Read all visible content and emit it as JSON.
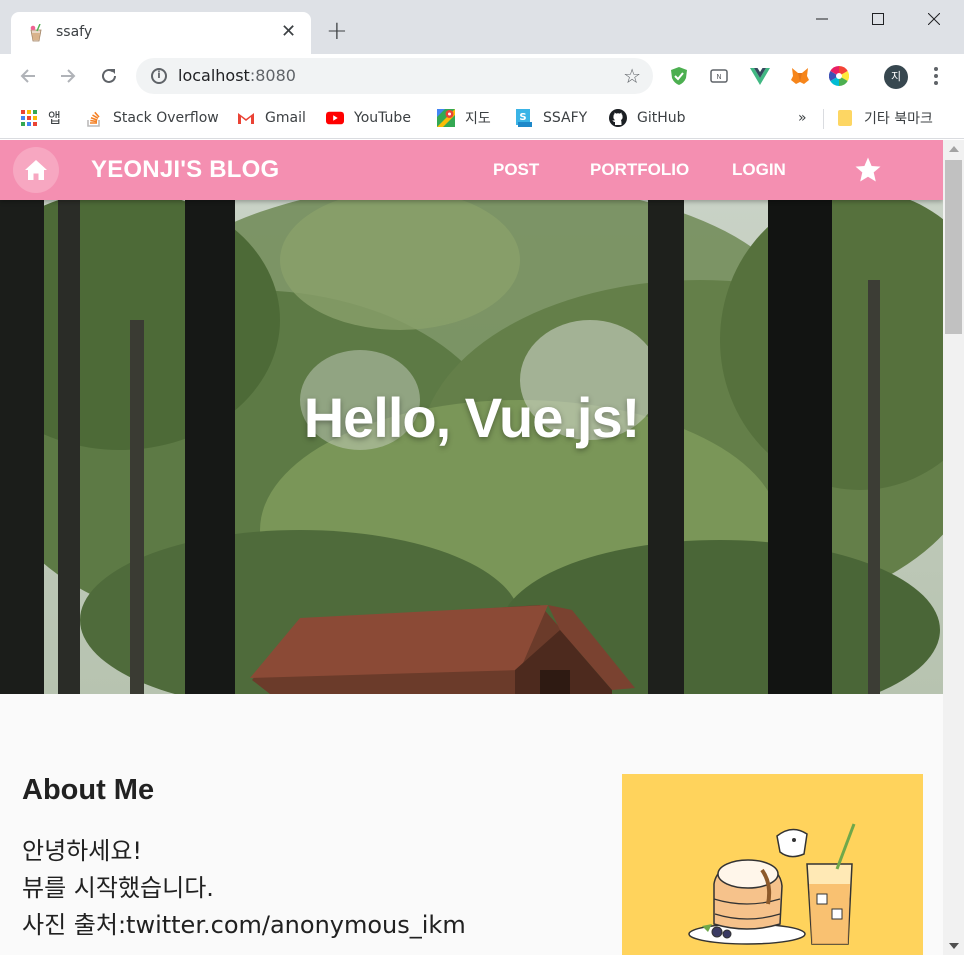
{
  "browser": {
    "tab_title": "ssafy",
    "url_host": "localhost",
    "url_port": ":8080",
    "profile_initial": "지",
    "bookmarks": [
      {
        "label": "앱",
        "icon": "apps-grid-icon"
      },
      {
        "label": "Stack Overflow",
        "icon": "stackoverflow-icon"
      },
      {
        "label": "Gmail",
        "icon": "gmail-icon"
      },
      {
        "label": "YouTube",
        "icon": "youtube-icon"
      },
      {
        "label": "지도",
        "icon": "maps-icon"
      },
      {
        "label": "SSAFY",
        "icon": "ssafy-icon"
      },
      {
        "label": "GitHub",
        "icon": "github-icon"
      }
    ],
    "overflow_label": "»",
    "other_bookmarks": "기타 북마크"
  },
  "appbar": {
    "brand": "YEONJI'S BLOG",
    "nav": [
      "POST",
      "PORTFOLIO",
      "LOGIN"
    ],
    "color": "#f48fb1"
  },
  "hero": {
    "title": "Hello, Vue.js!"
  },
  "about": {
    "title": "About Me",
    "lines": [
      "안녕하세요!",
      "뷰를 시작했습니다.",
      "사진 출처:twitter.com/anonymous_ikm"
    ],
    "image_bg": "#ffd35c"
  }
}
